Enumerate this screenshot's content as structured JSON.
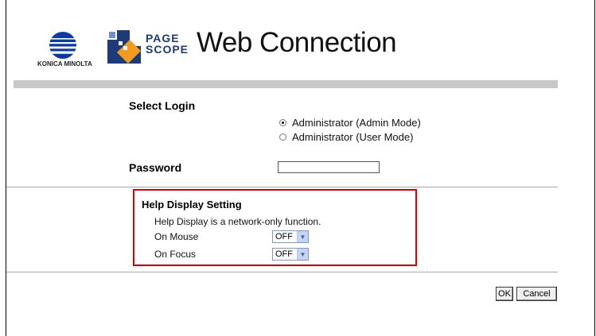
{
  "header": {
    "brand_text": "KONICA MINOLTA",
    "pagescope_line1": "PAGE",
    "pagescope_line2": "SCOPE",
    "app_title": "Web Connection"
  },
  "login": {
    "select_login_label": "Select Login",
    "options": [
      {
        "label": "Administrator (Admin Mode)",
        "selected": true
      },
      {
        "label": "Administrator (User Mode)",
        "selected": false
      }
    ],
    "password_label": "Password",
    "password_value": ""
  },
  "help": {
    "title": "Help Display Setting",
    "note": "Help Display is a network-only function.",
    "on_mouse_label": "On Mouse",
    "on_mouse_value": "OFF",
    "on_focus_label": "On Focus",
    "on_focus_value": "OFF",
    "highlight_color": "#e00000"
  },
  "actions": {
    "ok_label": "OK",
    "cancel_label": "Cancel"
  }
}
